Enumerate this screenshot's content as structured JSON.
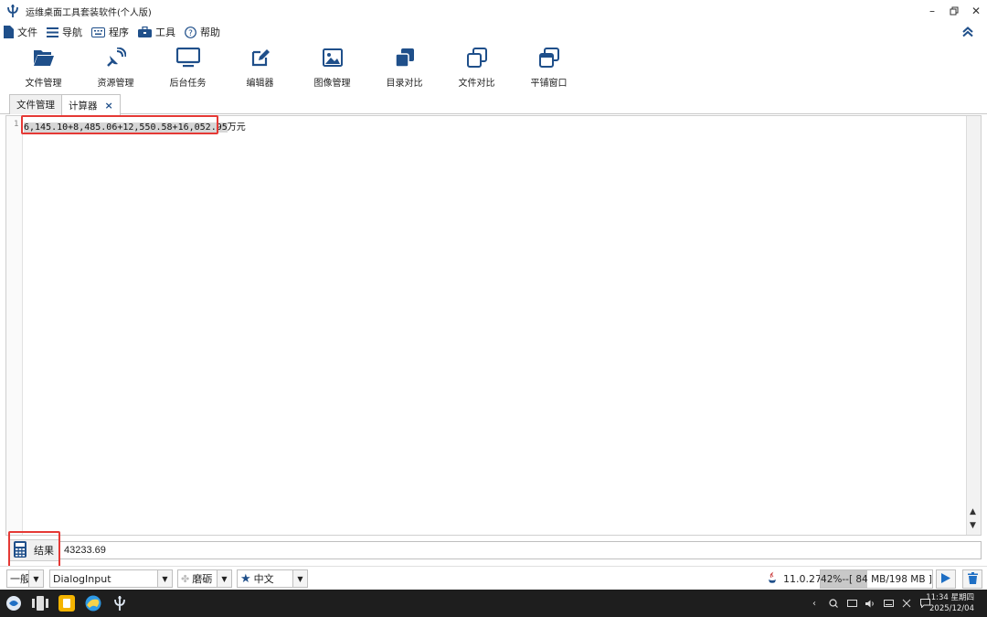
{
  "window": {
    "title": "运维桌面工具套装软件(个人版)",
    "icons": {
      "app": "app-logo-icon",
      "minimize": "minimize-icon",
      "restore": "restore-icon",
      "close": "close-icon"
    }
  },
  "menubar": {
    "items": [
      {
        "label": "文件",
        "icon": "file-icon"
      },
      {
        "label": "导航",
        "icon": "list-icon"
      },
      {
        "label": "程序",
        "icon": "keyboard-icon"
      },
      {
        "label": "工具",
        "icon": "toolbox-icon"
      },
      {
        "label": "帮助",
        "icon": "help-icon"
      }
    ],
    "collapse_icon": "chevron-double-up-icon"
  },
  "toolbar": {
    "items": [
      {
        "label": "文件管理",
        "icon": "folder-open-icon"
      },
      {
        "label": "资源管理",
        "icon": "satellite-icon"
      },
      {
        "label": "后台任务",
        "icon": "monitor-icon"
      },
      {
        "label": "编辑器",
        "icon": "edit-icon"
      },
      {
        "label": "图像管理",
        "icon": "image-icon"
      },
      {
        "label": "目录对比",
        "icon": "stacked-squares-icon"
      },
      {
        "label": "文件对比",
        "icon": "overlap-squares-icon"
      },
      {
        "label": "平铺窗口",
        "icon": "tile-windows-icon"
      }
    ]
  },
  "tabs": [
    {
      "label": "文件管理",
      "active": false
    },
    {
      "label": "计算器",
      "active": true,
      "close": "×"
    }
  ],
  "editor": {
    "line_number": "1",
    "expression": "6,145.10+8,485.06+12,550.58+16,052.95",
    "suffix": "万元"
  },
  "result": {
    "button_label": "结果",
    "icon": "calculator-icon",
    "value": "43233.69"
  },
  "statusbar": {
    "style_combo": "一般",
    "font_combo": "DialogInput",
    "theme_combo": "磨砺",
    "theme_icon": "maple-leaf-icon",
    "language_combo": "中文",
    "language_icon": "star-icon",
    "java_icon": "java-icon",
    "version": "11.0.27",
    "memory_text": "42%--[ 84 MB/198 MB ]",
    "memory_percent": 42,
    "run_icon": "play-icon",
    "trash_icon": "trash-icon"
  },
  "taskbar": {
    "clock_time": "11:34 星期四",
    "clock_date": "2025/12/04",
    "apps": [
      "start-icon",
      "task-view-icon",
      "files-app-icon",
      "browser-icon",
      "app-logo-icon"
    ],
    "tray": [
      "chevron-left-icon",
      "search-icon",
      "screen-icon",
      "volume-icon",
      "keyboard-icon",
      "network-icon",
      "notification-icon"
    ]
  },
  "colors": {
    "accent": "#1f4f8a",
    "highlight_red": "#e53935",
    "taskbar_bg": "#1e1e1e"
  }
}
